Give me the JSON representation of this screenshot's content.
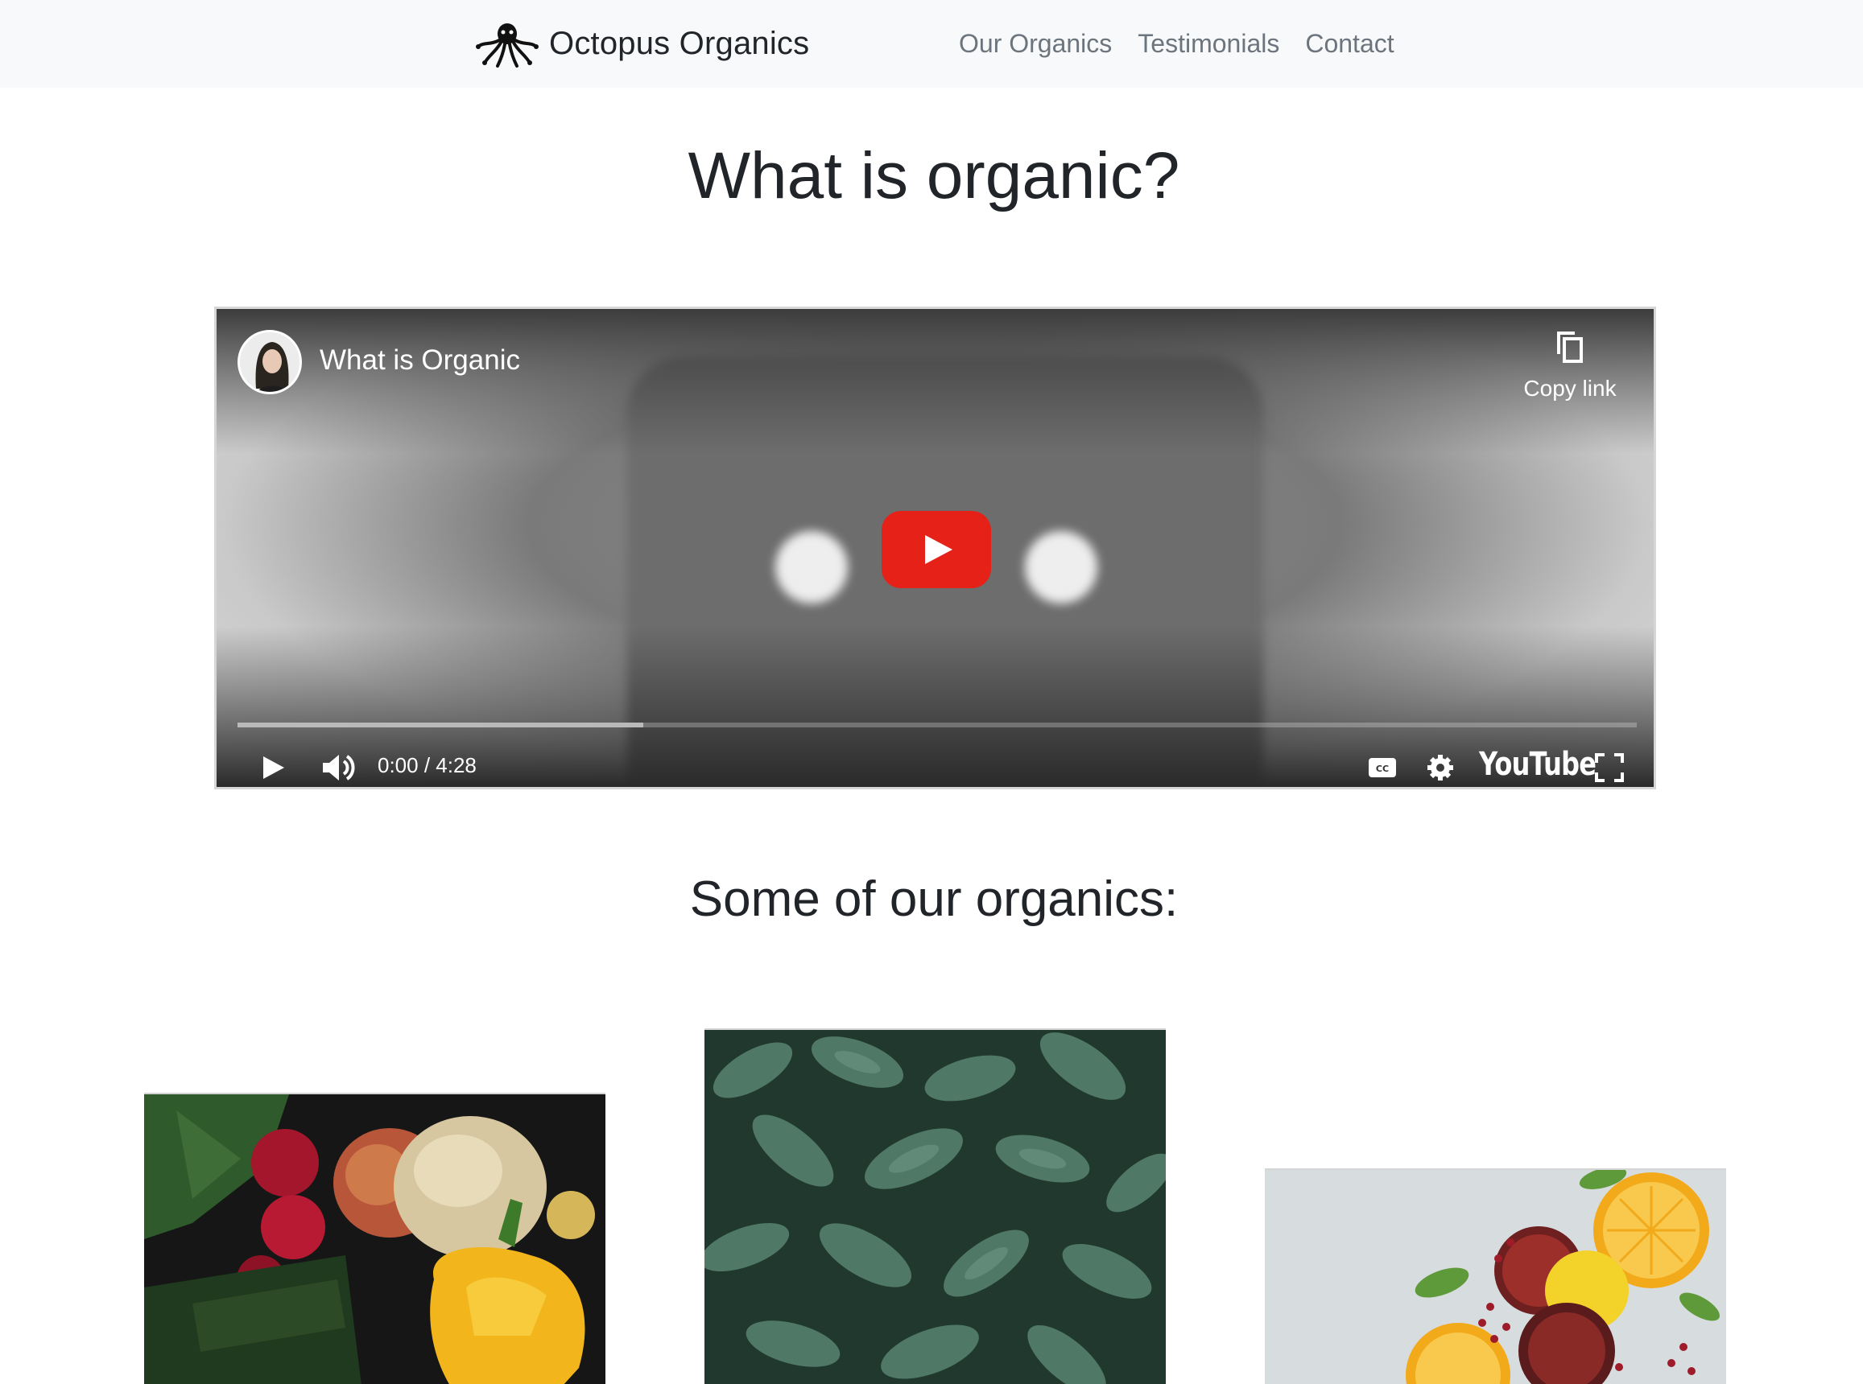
{
  "navbar": {
    "brand": "Octopus Organics",
    "links": [
      "Our Organics",
      "Testimonials",
      "Contact"
    ]
  },
  "main": {
    "heading": "What is organic?",
    "subheading": "Some of our organics:"
  },
  "video": {
    "title": "What is Organic",
    "copy_link_label": "Copy link",
    "time": "0:00 / 4:28",
    "youtube_label": "YouTube",
    "progress_fraction": 0.29
  },
  "colors": {
    "navbar_bg": "#f8f9fa",
    "nav_link": "#6c757d",
    "youtube_red": "#e62117"
  }
}
